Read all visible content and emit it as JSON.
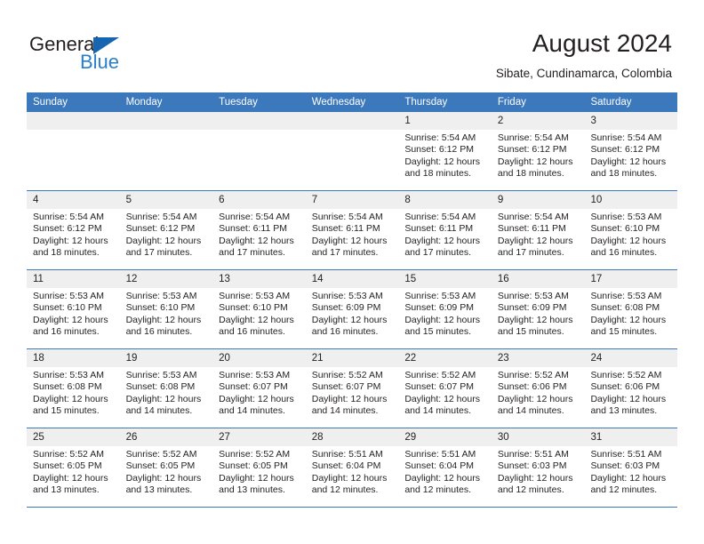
{
  "brand": {
    "name_part1": "General",
    "name_part2": "Blue",
    "accent_color": "#2a7fc9",
    "triangle_color": "#1565b0"
  },
  "header": {
    "title": "August 2024",
    "subtitle": "Sibate, Cundinamarca, Colombia"
  },
  "calendar": {
    "header_color": "#3b78bc",
    "day_band_color": "#efefef",
    "weekdays": [
      "Sunday",
      "Monday",
      "Tuesday",
      "Wednesday",
      "Thursday",
      "Friday",
      "Saturday"
    ],
    "weeks": [
      [
        {
          "day": "",
          "empty": true
        },
        {
          "day": "",
          "empty": true
        },
        {
          "day": "",
          "empty": true
        },
        {
          "day": "",
          "empty": true
        },
        {
          "day": "1",
          "sunrise": "Sunrise: 5:54 AM",
          "sunset": "Sunset: 6:12 PM",
          "daylight": "Daylight: 12 hours and 18 minutes."
        },
        {
          "day": "2",
          "sunrise": "Sunrise: 5:54 AM",
          "sunset": "Sunset: 6:12 PM",
          "daylight": "Daylight: 12 hours and 18 minutes."
        },
        {
          "day": "3",
          "sunrise": "Sunrise: 5:54 AM",
          "sunset": "Sunset: 6:12 PM",
          "daylight": "Daylight: 12 hours and 18 minutes."
        }
      ],
      [
        {
          "day": "4",
          "sunrise": "Sunrise: 5:54 AM",
          "sunset": "Sunset: 6:12 PM",
          "daylight": "Daylight: 12 hours and 18 minutes."
        },
        {
          "day": "5",
          "sunrise": "Sunrise: 5:54 AM",
          "sunset": "Sunset: 6:12 PM",
          "daylight": "Daylight: 12 hours and 17 minutes."
        },
        {
          "day": "6",
          "sunrise": "Sunrise: 5:54 AM",
          "sunset": "Sunset: 6:11 PM",
          "daylight": "Daylight: 12 hours and 17 minutes."
        },
        {
          "day": "7",
          "sunrise": "Sunrise: 5:54 AM",
          "sunset": "Sunset: 6:11 PM",
          "daylight": "Daylight: 12 hours and 17 minutes."
        },
        {
          "day": "8",
          "sunrise": "Sunrise: 5:54 AM",
          "sunset": "Sunset: 6:11 PM",
          "daylight": "Daylight: 12 hours and 17 minutes."
        },
        {
          "day": "9",
          "sunrise": "Sunrise: 5:54 AM",
          "sunset": "Sunset: 6:11 PM",
          "daylight": "Daylight: 12 hours and 17 minutes."
        },
        {
          "day": "10",
          "sunrise": "Sunrise: 5:53 AM",
          "sunset": "Sunset: 6:10 PM",
          "daylight": "Daylight: 12 hours and 16 minutes."
        }
      ],
      [
        {
          "day": "11",
          "sunrise": "Sunrise: 5:53 AM",
          "sunset": "Sunset: 6:10 PM",
          "daylight": "Daylight: 12 hours and 16 minutes."
        },
        {
          "day": "12",
          "sunrise": "Sunrise: 5:53 AM",
          "sunset": "Sunset: 6:10 PM",
          "daylight": "Daylight: 12 hours and 16 minutes."
        },
        {
          "day": "13",
          "sunrise": "Sunrise: 5:53 AM",
          "sunset": "Sunset: 6:10 PM",
          "daylight": "Daylight: 12 hours and 16 minutes."
        },
        {
          "day": "14",
          "sunrise": "Sunrise: 5:53 AM",
          "sunset": "Sunset: 6:09 PM",
          "daylight": "Daylight: 12 hours and 16 minutes."
        },
        {
          "day": "15",
          "sunrise": "Sunrise: 5:53 AM",
          "sunset": "Sunset: 6:09 PM",
          "daylight": "Daylight: 12 hours and 15 minutes."
        },
        {
          "day": "16",
          "sunrise": "Sunrise: 5:53 AM",
          "sunset": "Sunset: 6:09 PM",
          "daylight": "Daylight: 12 hours and 15 minutes."
        },
        {
          "day": "17",
          "sunrise": "Sunrise: 5:53 AM",
          "sunset": "Sunset: 6:08 PM",
          "daylight": "Daylight: 12 hours and 15 minutes."
        }
      ],
      [
        {
          "day": "18",
          "sunrise": "Sunrise: 5:53 AM",
          "sunset": "Sunset: 6:08 PM",
          "daylight": "Daylight: 12 hours and 15 minutes."
        },
        {
          "day": "19",
          "sunrise": "Sunrise: 5:53 AM",
          "sunset": "Sunset: 6:08 PM",
          "daylight": "Daylight: 12 hours and 14 minutes."
        },
        {
          "day": "20",
          "sunrise": "Sunrise: 5:53 AM",
          "sunset": "Sunset: 6:07 PM",
          "daylight": "Daylight: 12 hours and 14 minutes."
        },
        {
          "day": "21",
          "sunrise": "Sunrise: 5:52 AM",
          "sunset": "Sunset: 6:07 PM",
          "daylight": "Daylight: 12 hours and 14 minutes."
        },
        {
          "day": "22",
          "sunrise": "Sunrise: 5:52 AM",
          "sunset": "Sunset: 6:07 PM",
          "daylight": "Daylight: 12 hours and 14 minutes."
        },
        {
          "day": "23",
          "sunrise": "Sunrise: 5:52 AM",
          "sunset": "Sunset: 6:06 PM",
          "daylight": "Daylight: 12 hours and 14 minutes."
        },
        {
          "day": "24",
          "sunrise": "Sunrise: 5:52 AM",
          "sunset": "Sunset: 6:06 PM",
          "daylight": "Daylight: 12 hours and 13 minutes."
        }
      ],
      [
        {
          "day": "25",
          "sunrise": "Sunrise: 5:52 AM",
          "sunset": "Sunset: 6:05 PM",
          "daylight": "Daylight: 12 hours and 13 minutes."
        },
        {
          "day": "26",
          "sunrise": "Sunrise: 5:52 AM",
          "sunset": "Sunset: 6:05 PM",
          "daylight": "Daylight: 12 hours and 13 minutes."
        },
        {
          "day": "27",
          "sunrise": "Sunrise: 5:52 AM",
          "sunset": "Sunset: 6:05 PM",
          "daylight": "Daylight: 12 hours and 13 minutes."
        },
        {
          "day": "28",
          "sunrise": "Sunrise: 5:51 AM",
          "sunset": "Sunset: 6:04 PM",
          "daylight": "Daylight: 12 hours and 12 minutes."
        },
        {
          "day": "29",
          "sunrise": "Sunrise: 5:51 AM",
          "sunset": "Sunset: 6:04 PM",
          "daylight": "Daylight: 12 hours and 12 minutes."
        },
        {
          "day": "30",
          "sunrise": "Sunrise: 5:51 AM",
          "sunset": "Sunset: 6:03 PM",
          "daylight": "Daylight: 12 hours and 12 minutes."
        },
        {
          "day": "31",
          "sunrise": "Sunrise: 5:51 AM",
          "sunset": "Sunset: 6:03 PM",
          "daylight": "Daylight: 12 hours and 12 minutes."
        }
      ]
    ]
  }
}
